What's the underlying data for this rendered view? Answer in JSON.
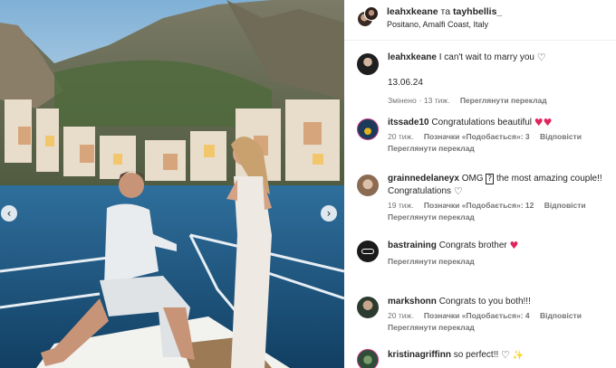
{
  "photo": {
    "description_icons": [
      "chevron-left-icon",
      "chevron-right-icon"
    ],
    "colors": {
      "sea": "#1f5f8f",
      "sky": "#8fb9d8",
      "cliff": "#6b6a58"
    }
  },
  "header": {
    "user1": "leahxkeane",
    "conjunction": "та",
    "user2": "tayhbellis_",
    "location": "Positano, Amalfi Coast, Italy"
  },
  "caption": {
    "user": "leahxkeane",
    "text": "I can't wait to marry you",
    "date": "13.06.24",
    "edited": "Змінено",
    "age": "13 тиж.",
    "translate": "Переглянути переклад"
  },
  "comments": [
    {
      "user": "itssade10",
      "text": "Congratulations beautiful",
      "age": "20 тиж.",
      "likes": "Позначки «Подобається»: 3",
      "reply": "Відповісти",
      "translate": "Переглянути переклад"
    },
    {
      "user": "grainnedelaneyx",
      "text": "OMG",
      "text2": "the most amazing couple!! Congratulations",
      "age": "19 тиж.",
      "likes": "Позначки «Подобається»: 12",
      "reply": "Відповісти",
      "translate": "Переглянути переклад"
    },
    {
      "user": "bastraining",
      "text": "Congrats brother",
      "translate": "Переглянути переклад"
    },
    {
      "user": "markshonn",
      "text": "Congrats to you both!!!",
      "age": "20 тиж.",
      "likes": "Позначки «Подобається»: 4",
      "reply": "Відповісти",
      "translate": "Переглянути переклад"
    },
    {
      "user": "kristinagriffinn",
      "text": "so perfect!!"
    }
  ],
  "accent_colors": {
    "heart_red": "#e0245e",
    "muted_text": "#737373"
  }
}
